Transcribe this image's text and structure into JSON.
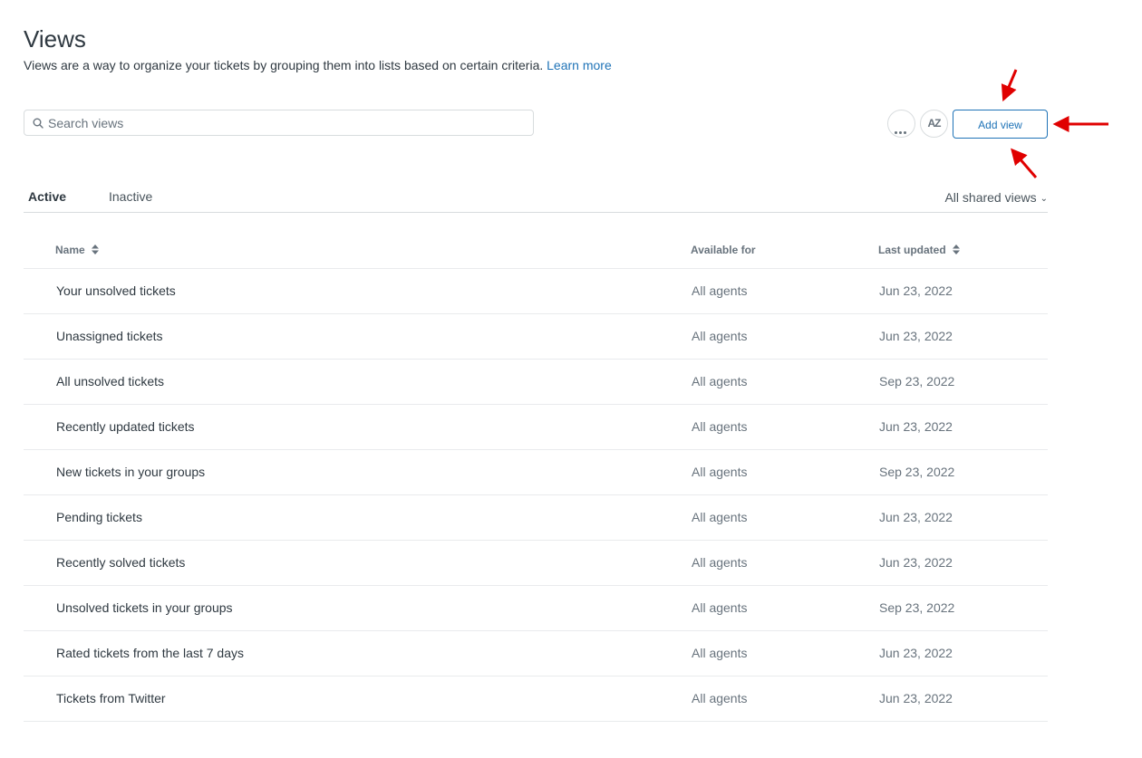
{
  "header": {
    "title": "Views",
    "description": "Views are a way to organize your tickets by grouping them into lists based on certain criteria.",
    "learn_more": "Learn more"
  },
  "search": {
    "placeholder": "Search views",
    "icon": "search-icon"
  },
  "toolbar": {
    "more_icon": "more-dots-icon",
    "sort_label": "AZ",
    "add_label": "Add view"
  },
  "tabs": [
    {
      "label": "Active",
      "selected": true
    },
    {
      "label": "Inactive",
      "selected": false
    }
  ],
  "filter": {
    "label": "All shared views",
    "icon": "chevron-down-icon"
  },
  "table": {
    "columns": [
      "Name",
      "Available for",
      "Last updated"
    ],
    "rows": [
      {
        "name": "Your unsolved tickets",
        "available": "All agents",
        "updated": "Jun 23, 2022"
      },
      {
        "name": "Unassigned tickets",
        "available": "All agents",
        "updated": "Jun 23, 2022"
      },
      {
        "name": "All unsolved tickets",
        "available": "All agents",
        "updated": "Sep 23, 2022"
      },
      {
        "name": "Recently updated tickets",
        "available": "All agents",
        "updated": "Jun 23, 2022"
      },
      {
        "name": "New tickets in your groups",
        "available": "All agents",
        "updated": "Sep 23, 2022"
      },
      {
        "name": "Pending tickets",
        "available": "All agents",
        "updated": "Jun 23, 2022"
      },
      {
        "name": "Recently solved tickets",
        "available": "All agents",
        "updated": "Jun 23, 2022"
      },
      {
        "name": "Unsolved tickets in your groups",
        "available": "All agents",
        "updated": "Sep 23, 2022"
      },
      {
        "name": "Rated tickets from the last 7 days",
        "available": "All agents",
        "updated": "Jun 23, 2022"
      },
      {
        "name": "Tickets from Twitter",
        "available": "All agents",
        "updated": "Jun 23, 2022"
      }
    ]
  },
  "colors": {
    "accent": "#1f73b7",
    "annotation": "#e00000",
    "text": "#2f3941",
    "muted": "#68737d"
  }
}
